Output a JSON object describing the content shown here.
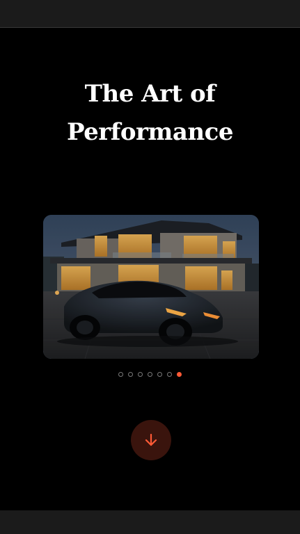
{
  "hero": {
    "title_line1": "The Art of",
    "title_line2": "Performance"
  },
  "carousel": {
    "slide_count": 7,
    "active_index": 6,
    "image_alt": "dark sports car parked in front of a modern illuminated house at dusk"
  },
  "colors": {
    "background": "#000000",
    "accent": "#ff5a36",
    "bar": "#1b1b1b",
    "scroll_button_bg": "#3a140d"
  },
  "icons": {
    "scroll": "arrow-down-icon"
  }
}
